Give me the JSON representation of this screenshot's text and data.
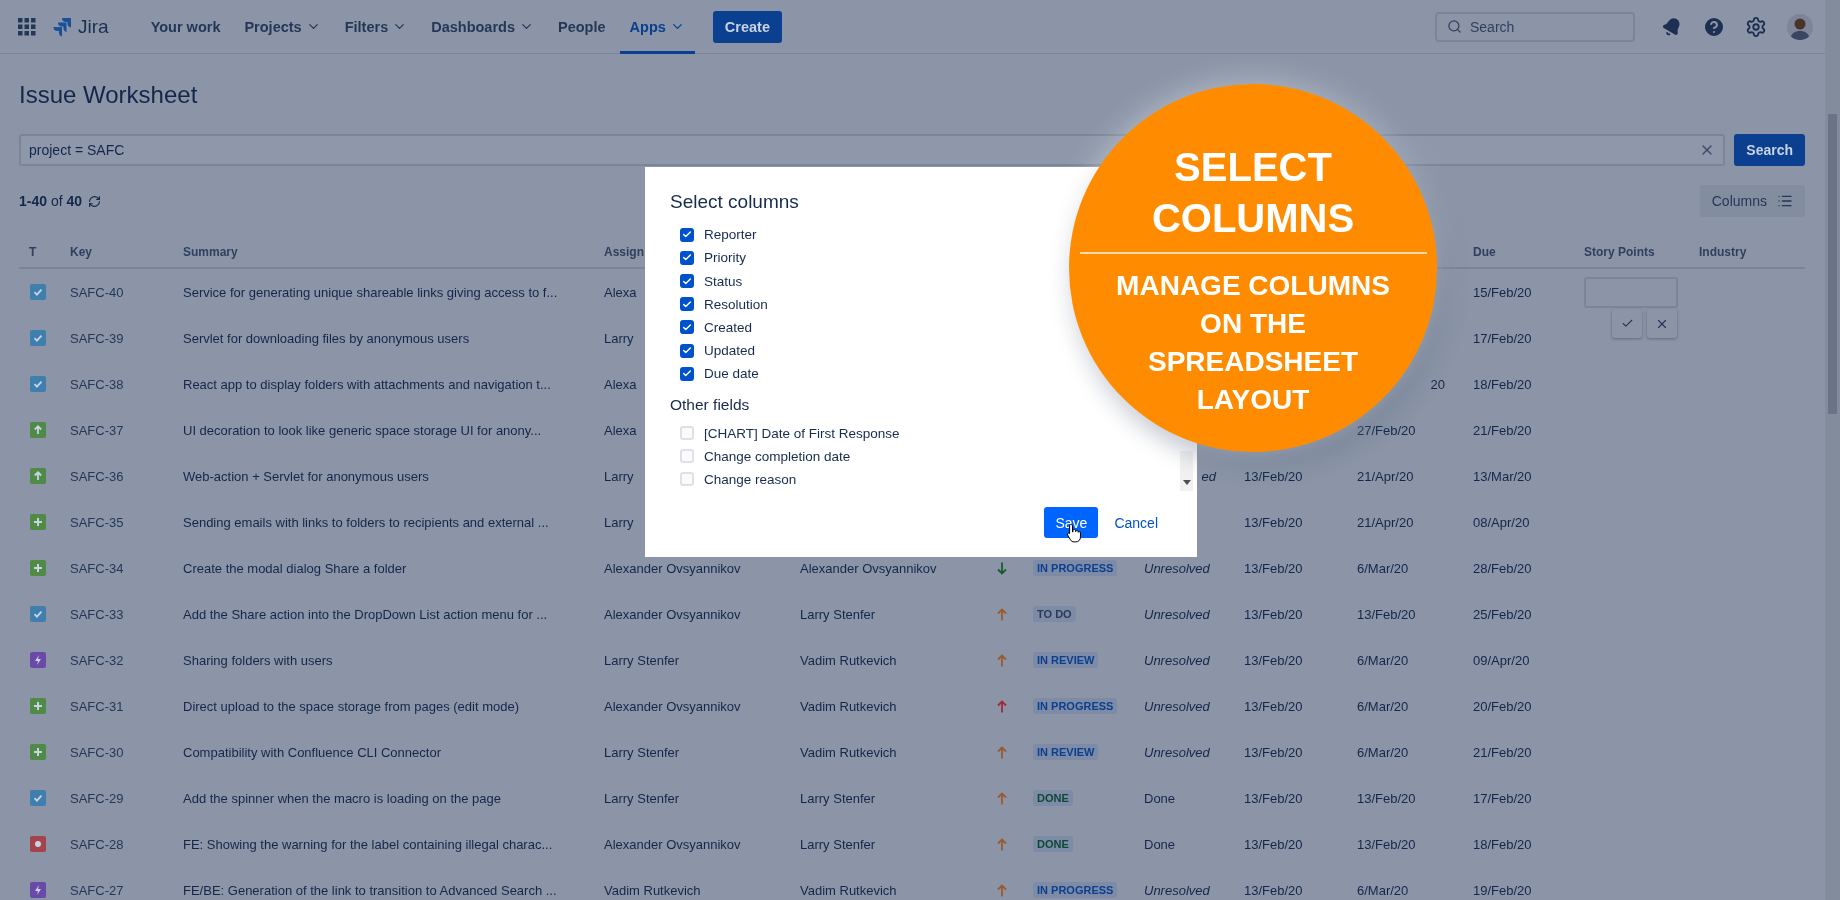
{
  "nav": {
    "logo": "Jira",
    "items": [
      {
        "label": "Your work",
        "dropdown": false,
        "selected": false
      },
      {
        "label": "Projects",
        "dropdown": true,
        "selected": false
      },
      {
        "label": "Filters",
        "dropdown": true,
        "selected": false
      },
      {
        "label": "Dashboards",
        "dropdown": true,
        "selected": false
      },
      {
        "label": "People",
        "dropdown": false,
        "selected": false
      },
      {
        "label": "Apps",
        "dropdown": true,
        "selected": true
      }
    ],
    "create": "Create",
    "search_placeholder": "Search"
  },
  "page": {
    "title": "Issue Worksheet",
    "query": "project = SAFC",
    "search_button": "Search",
    "count": "**1-40** of **40**",
    "columns_button": "Columns"
  },
  "table": {
    "headers": {
      "type": "T",
      "key": "Key",
      "summary": "Summary",
      "assignee": "Assign",
      "due": "Due",
      "story_points": "Story Points",
      "industry": "Industry"
    },
    "rows": [
      {
        "kind": "task",
        "key": "SAFC-40",
        "summary": "Service for generating unique shareable links giving access to f...",
        "assignee": "Alexa",
        "due": "15/Feb/20",
        "story_points": {
          "editing": true
        }
      },
      {
        "kind": "task",
        "key": "SAFC-39",
        "summary": "Servlet for downloading files by anonymous users",
        "assignee": "Larry",
        "due": "17/Feb/20"
      },
      {
        "kind": "task",
        "key": "SAFC-38",
        "summary": "React app to display folders with attachments and navigation t...",
        "assignee": "Alexa",
        "updated": {
          "text": "20",
          "cut_start": true
        },
        "due": "18/Feb/20"
      },
      {
        "kind": "improvement",
        "key": "SAFC-37",
        "summary": "UI decoration to look like generic space storage UI for anony...",
        "assignee": "Alexa",
        "updated": "27/Feb/20",
        "due": "21/Feb/20"
      },
      {
        "kind": "improvement",
        "key": "SAFC-36",
        "summary": "Web-action + Servlet for anonymous users",
        "assignee": "Larry",
        "resolution": {
          "text": "ed",
          "resolved": false,
          "cut_start": true
        },
        "created": "13/Feb/20",
        "updated": "21/Apr/20",
        "due": "13/Mar/20"
      },
      {
        "kind": "feature",
        "key": "SAFC-35",
        "summary": "Sending emails with links to folders to recipients and external ...",
        "assignee": "Larry",
        "created": "13/Feb/20",
        "updated": "21/Apr/20",
        "due": "08/Apr/20"
      },
      {
        "kind": "feature",
        "key": "SAFC-34",
        "summary": "Create the modal dialog Share a folder",
        "assignee": "Alexander Ovsyannikov",
        "reporter": "Alexander Ovsyannikov",
        "priority": {
          "kind": "low"
        },
        "status": {
          "text": "IN PROGRESS",
          "color": "#0b3f8f"
        },
        "resolution": {
          "text": "Unresolved",
          "resolved": false
        },
        "created": "13/Feb/20",
        "updated": "6/Mar/20",
        "due": "28/Feb/20"
      },
      {
        "kind": "task",
        "key": "SAFC-33",
        "summary": "Add the Share action into the DropDown List action menu for ...",
        "assignee": "Alexander Ovsyannikov",
        "reporter": "Larry Stenfer",
        "priority": {
          "kind": "medium"
        },
        "status": {
          "text": "TO DO",
          "color": "#2c3a55"
        },
        "resolution": {
          "text": "Unresolved",
          "resolved": false
        },
        "created": "13/Feb/20",
        "updated": "13/Feb/20",
        "due": "25/Feb/20"
      },
      {
        "kind": "epic",
        "key": "SAFC-32",
        "summary": "Sharing folders with users",
        "assignee": "Larry Stenfer",
        "reporter": "Vadim Rutkevich",
        "priority": {
          "kind": "medium"
        },
        "status": {
          "text": "IN REVIEW",
          "color": "#0b3f8f"
        },
        "resolution": {
          "text": "Unresolved",
          "resolved": false
        },
        "created": "13/Feb/20",
        "updated": "6/Mar/20",
        "due": "09/Apr/20"
      },
      {
        "kind": "feature",
        "key": "SAFC-31",
        "summary": "Direct upload to the space storage from pages (edit mode)",
        "assignee": "Alexander Ovsyannikov",
        "reporter": "Vadim Rutkevich",
        "priority": {
          "kind": "high"
        },
        "status": {
          "text": "IN PROGRESS",
          "color": "#0b3f8f"
        },
        "resolution": {
          "text": "Unresolved",
          "resolved": false
        },
        "created": "13/Feb/20",
        "updated": "6/Mar/20",
        "due": "20/Feb/20"
      },
      {
        "kind": "feature",
        "key": "SAFC-30",
        "summary": "Compatibility with Confluence CLI Connector",
        "assignee": "Larry Stenfer",
        "reporter": "Vadim Rutkevich",
        "priority": {
          "kind": "medium"
        },
        "status": {
          "text": "IN REVIEW",
          "color": "#0b3f8f"
        },
        "resolution": {
          "text": "Unresolved",
          "resolved": false
        },
        "created": "13/Feb/20",
        "updated": "6/Mar/20",
        "due": "21/Feb/20"
      },
      {
        "kind": "task",
        "key": "SAFC-29",
        "summary": "Add the spinner when the macro is loading on the page",
        "assignee": "Larry Stenfer",
        "reporter": "Larry Stenfer",
        "priority": {
          "kind": "medium"
        },
        "status": {
          "text": "DONE",
          "color": "#0c4a36"
        },
        "resolution": {
          "text": "Done",
          "resolved": true
        },
        "created": "13/Feb/20",
        "updated": "13/Feb/20",
        "due": "17/Feb/20"
      },
      {
        "kind": "bug",
        "key": "SAFC-28",
        "summary": "FE: Showing the warning for the label containing illegal charac...",
        "assignee": "Alexander Ovsyannikov",
        "reporter": "Larry Stenfer",
        "priority": {
          "kind": "medium"
        },
        "status": {
          "text": "DONE",
          "color": "#0c4a36"
        },
        "resolution": {
          "text": "Done",
          "resolved": true
        },
        "created": "13/Feb/20",
        "updated": "13/Feb/20",
        "due": "18/Feb/20"
      },
      {
        "kind": "epic",
        "key": "SAFC-27",
        "summary": "FE/BE: Generation of the link to transition to Advanced Search ...",
        "assignee": "Vadim Rutkevich",
        "reporter": "Vadim Rutkevich",
        "priority": {
          "kind": "medium"
        },
        "status": {
          "text": "IN PROGRESS",
          "color": "#0b3f8f"
        },
        "resolution": {
          "text": "Unresolved",
          "resolved": false
        },
        "created": "13/Feb/20",
        "updated": "6/Mar/20",
        "due": "19/Feb/20"
      }
    ]
  },
  "dialog": {
    "title": "Select columns",
    "selected": [
      {
        "label": "Reporter",
        "checked": true
      },
      {
        "label": "Priority",
        "checked": true
      },
      {
        "label": "Status",
        "checked": true
      },
      {
        "label": "Resolution",
        "checked": true
      },
      {
        "label": "Created",
        "checked": true
      },
      {
        "label": "Updated",
        "checked": true
      },
      {
        "label": "Due date",
        "checked": true
      }
    ],
    "other_heading": "Other fields",
    "other": [
      {
        "label": "[CHART] Date of First Response",
        "checked": false
      },
      {
        "label": "Change completion date",
        "checked": false
      },
      {
        "label": "Change reason",
        "checked": false
      }
    ],
    "save": "Save",
    "cancel": "Cancel"
  },
  "callout": {
    "headline": [
      "SELECT",
      "COLUMNS"
    ],
    "subline": [
      "MANAGE COLUMNS",
      "ON THE",
      "SPREADSHEET",
      "LAYOUT"
    ]
  }
}
